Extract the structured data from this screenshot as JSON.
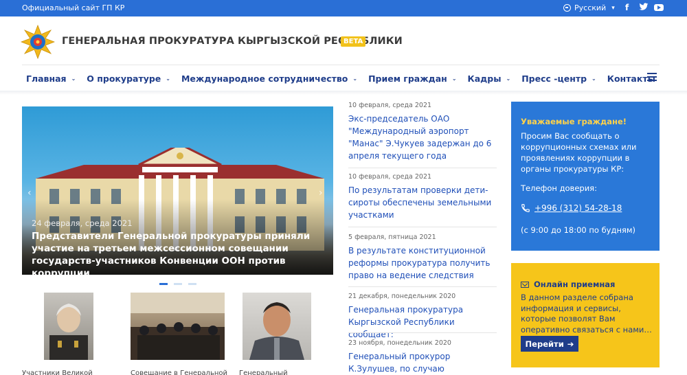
{
  "topbar": {
    "site_label": "Официальный сайт ГП КР",
    "language": "Русский",
    "social": [
      "facebook-icon",
      "twitter-icon",
      "youtube-icon"
    ]
  },
  "header": {
    "title": "ГЕНЕРАЛЬНАЯ ПРОКУРАТУРА КЫРГЫЗСКОЙ РЕСПУБЛИКИ",
    "badge": "BETA"
  },
  "nav": {
    "items": [
      {
        "label": "Главная",
        "dropdown": true
      },
      {
        "label": "О прокуратуре",
        "dropdown": true
      },
      {
        "label": "Международное сотрудничество",
        "dropdown": true
      },
      {
        "label": "Прием граждан",
        "dropdown": true
      },
      {
        "label": "Кадры",
        "dropdown": true
      },
      {
        "label": "Пресс -центр",
        "dropdown": true
      },
      {
        "label": "Контакты",
        "dropdown": false
      }
    ]
  },
  "slider": {
    "date": "24 февраля, среда 2021",
    "caption": "Представители Генеральной прокуратуры приняли участие на третьем межсессионном совещании государств-участников Конвенции ООН против коррупции",
    "active_slide": 1,
    "slide_count": 3
  },
  "thumbnails": {
    "captions": [
      "Участники Великой",
      "Совещание в Генеральной",
      "Генеральный"
    ]
  },
  "news": [
    {
      "date": "10 февраля, среда 2021",
      "title": "Экс-председатель ОАО \"Международный аэропорт \"Манас\" Э.Чукуев задержан до 6 апреля текущего года"
    },
    {
      "date": "10 февраля, среда 2021",
      "title": "По результатам проверки дети-сироты обеспечены земельными участками"
    },
    {
      "date": "5 февраля, пятница 2021",
      "title": "В результате конституционной реформы прокуратура получить право на ведение следствия"
    },
    {
      "date": "21 декабря, понедельник 2020",
      "title": "Генеральная прокуратура Кыргызской Республики сообщает:"
    },
    {
      "date": "23 ноября, понедельник 2020",
      "title": "Генеральный прокурор К.Зулушев, по случаю профессионального"
    }
  ],
  "appeal": {
    "heading": "Уважаемые граждане!",
    "text": "Просим Вас сообщать о коррупционных схемах или проявлениях коррупции в органы прокуратуры КР:",
    "phone_label": "Телефон доверия:",
    "phone": "+996 (312) 54-28-18",
    "hours": "(с 9:00 до 18:00 по будням)"
  },
  "online": {
    "heading": "Онлайн приемная",
    "text": "В данном разделе собрана информация и сервисы, которые позволят Вам оперативно связаться с нами…",
    "button": "Перейти"
  },
  "colors": {
    "accent": "#2a6fd6",
    "navy": "#1f3d8a",
    "yellow": "#f6c51a",
    "link": "#1f4fb8"
  }
}
